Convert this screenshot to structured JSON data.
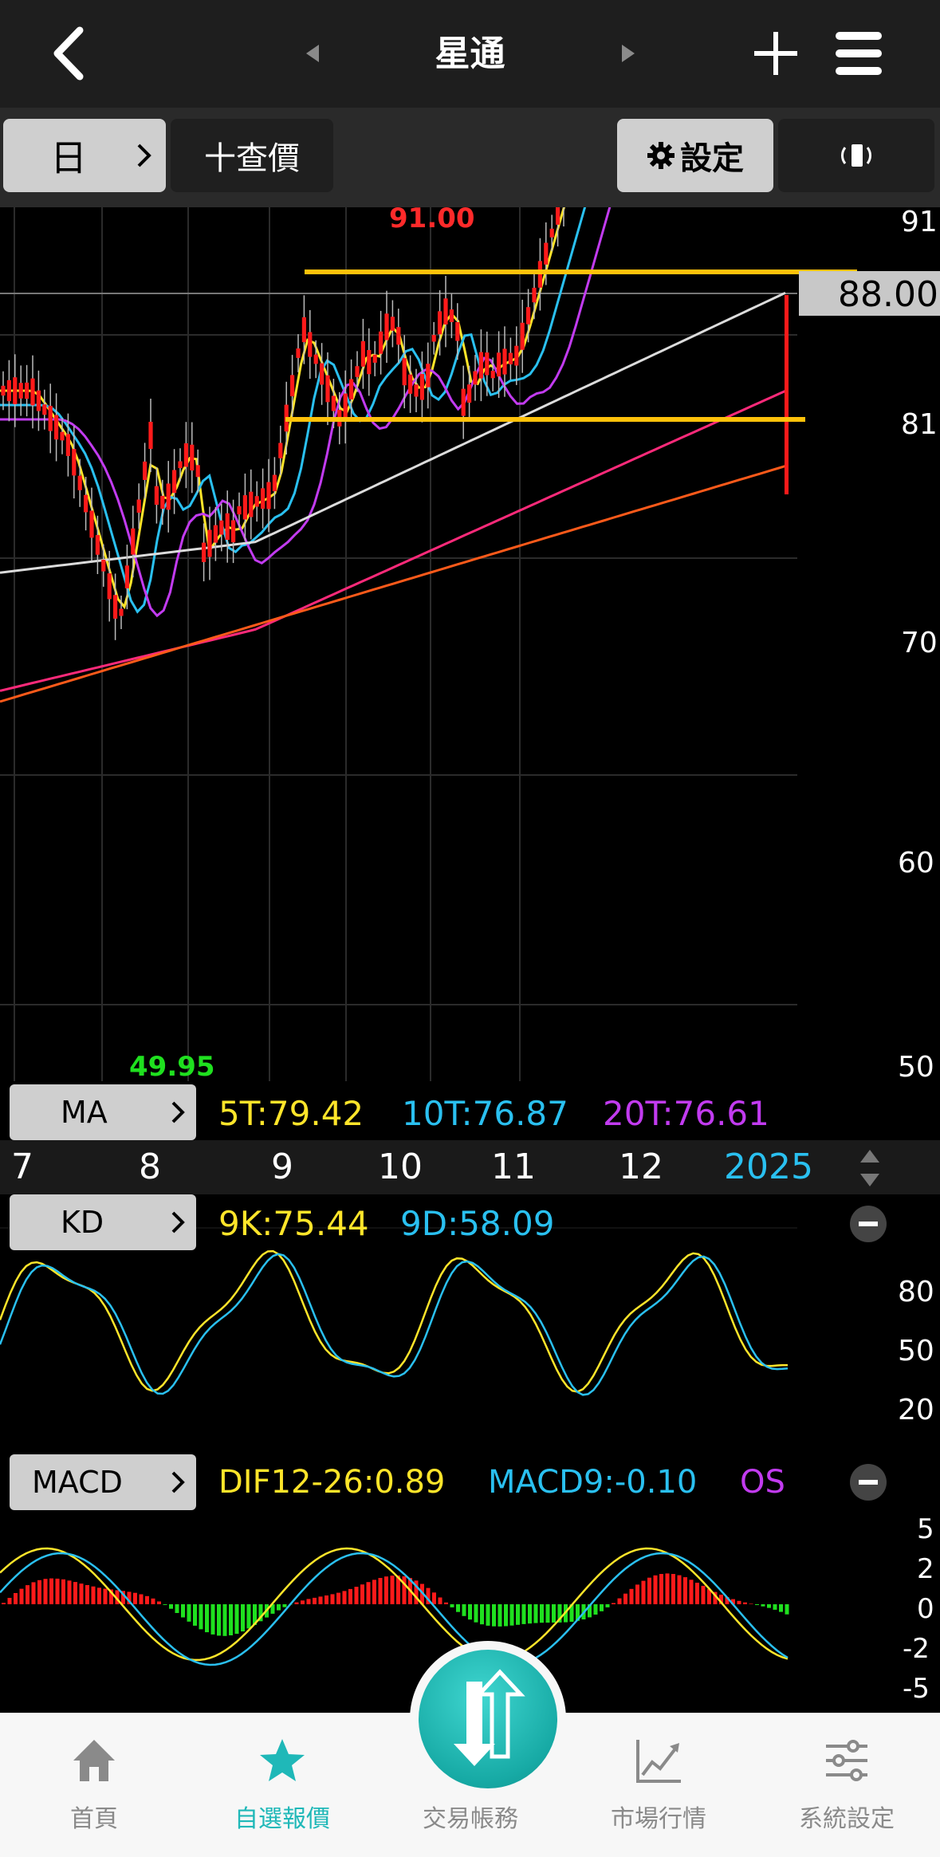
{
  "header": {
    "title": "星通"
  },
  "toolbar": {
    "period_label": "日",
    "quote_label": "十查價",
    "settings_label": "設定"
  },
  "price_axis": {
    "labels": [
      "91",
      "81",
      "70",
      "60",
      "50"
    ],
    "current_price": "88.00",
    "high_label": "91.00",
    "low_label": "49.95"
  },
  "ma_bar": {
    "label": "MA",
    "values": [
      {
        "text": "5T:79.42",
        "color": "#ffe52a"
      },
      {
        "text": "10T:76.87",
        "color": "#2ac0f0"
      },
      {
        "text": "20T:76.61",
        "color": "#c23bf0"
      }
    ]
  },
  "time_axis": {
    "labels": [
      "7",
      "8",
      "9",
      "10",
      "11",
      "12",
      "2025"
    ]
  },
  "kd_bar": {
    "label": "KD",
    "values": [
      {
        "text": "9K:75.44",
        "color": "#ffe52a"
      },
      {
        "text": "9D:58.09",
        "color": "#2ac0f0"
      }
    ],
    "axis_labels": [
      "80",
      "50",
      "20"
    ]
  },
  "macd_bar": {
    "label": "MACD",
    "values": [
      {
        "text": "DIF12-26:0.89",
        "color": "#ffe52a"
      },
      {
        "text": "MACD9:-0.10",
        "color": "#2ac0f0"
      },
      {
        "text": "OS",
        "color": "#c23bf0"
      }
    ],
    "axis_labels": [
      "5",
      "2",
      "0",
      "-2",
      "-5"
    ]
  },
  "tabs": [
    {
      "label": "首頁",
      "icon": "home-icon"
    },
    {
      "label": "自選報價",
      "icon": "star-icon"
    },
    {
      "label": "交易帳務",
      "icon": "trade-icon"
    },
    {
      "label": "市場行情",
      "icon": "market-chart-icon"
    },
    {
      "label": "系統設定",
      "icon": "sliders-icon"
    }
  ],
  "colors": {
    "up": "#ff1a1a",
    "down": "#1fe01f",
    "ma5": "#ffe52a",
    "ma10": "#2ac0f0",
    "ma20": "#c23bf0",
    "accent": "#1fb8b8"
  }
}
